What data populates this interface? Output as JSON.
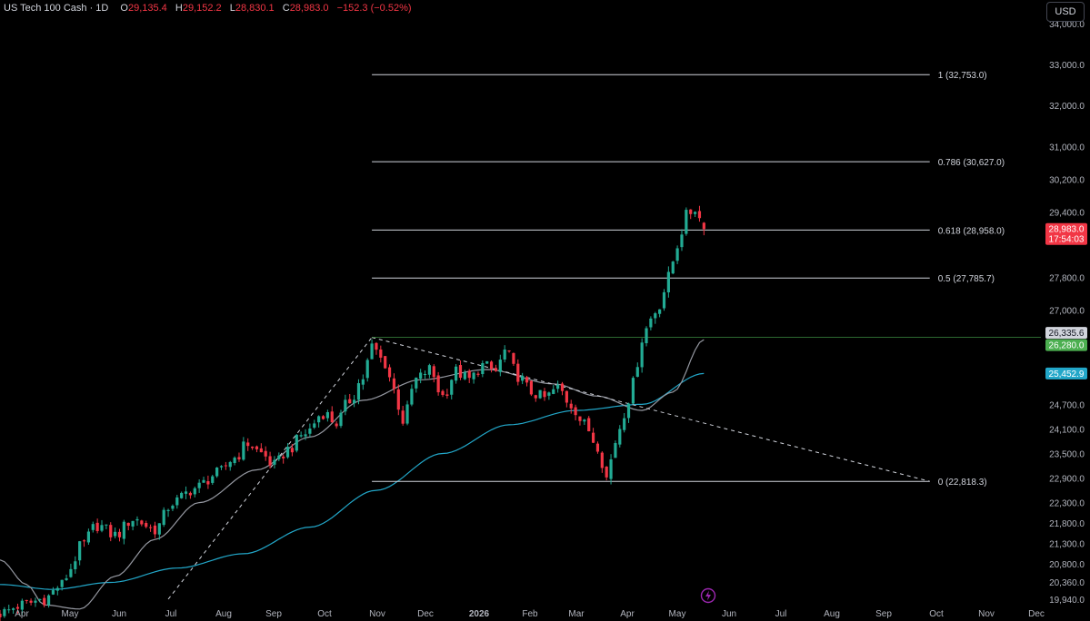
{
  "header": {
    "symbol": "US Tech 100 Cash · 1D",
    "open": "29,135.4",
    "high": "29,152.2",
    "low": "28,830.1",
    "close": "28,983.0",
    "change": "−152.3 (−0.52%)"
  },
  "currency": "USD",
  "colors": {
    "up": "#22ab94",
    "down": "#f23645",
    "ma_fast": "#9598a1",
    "ma_slow": "#22a7c9",
    "price_tag": "#f23645",
    "level_tag": "#4caf50",
    "ma_tag": "#22a7c9",
    "lightning_icon": "#9c27b0"
  },
  "chart_data": {
    "type": "candlestick",
    "x_labels": [
      "Apr",
      "May",
      "Jun",
      "Jul",
      "Aug",
      "Sep",
      "Oct",
      "Nov",
      "Dec",
      "2026",
      "Feb",
      "Mar",
      "Apr",
      "May",
      "Jun",
      "Jul",
      "Aug",
      "Sep",
      "Oct",
      "Nov",
      "Dec"
    ],
    "y_ticks": [
      "34,000.0",
      "33,000.0",
      "32,000.0",
      "31,000.0",
      "30,200.0",
      "29,400.0",
      "27,800.0",
      "27,000.0",
      "24,700.0",
      "24,100.0",
      "23,500.0",
      "22,900.0",
      "22,300.0",
      "21,800.0",
      "21,300.0",
      "20,800.0",
      "20,360.0",
      "19,940.0"
    ],
    "fib_levels": [
      {
        "label": "1 (32,753.0)",
        "value": 32753.0
      },
      {
        "label": "0.786 (30,627.0)",
        "value": 30627.0
      },
      {
        "label": "0.618 (28,958.0)",
        "value": 28958.0
      },
      {
        "label": "0.5 (27,785.7)",
        "value": 27785.7
      },
      {
        "label": "0 (22,818.3)",
        "value": 22818.3
      }
    ],
    "price_tags": [
      {
        "kind": "last",
        "value": 28983.0,
        "label": "28,983.0",
        "countdown": "17:54:03"
      },
      {
        "kind": "level",
        "value": 26335.6,
        "label": "26,335.6"
      },
      {
        "kind": "level-green",
        "value": 26280.0,
        "label": "26,280.0"
      },
      {
        "kind": "ma",
        "value": 25452.9,
        "label": "25,452.9"
      }
    ],
    "horizontal_level": 26335.6,
    "anchors": [
      {
        "t": 0,
        "v": 19600
      },
      {
        "t": 5,
        "v": 19800
      },
      {
        "t": 10,
        "v": 19950
      },
      {
        "t": 14,
        "v": 20300
      },
      {
        "t": 16,
        "v": 20700
      },
      {
        "t": 18,
        "v": 21200
      },
      {
        "t": 22,
        "v": 21750
      },
      {
        "t": 26,
        "v": 21500
      },
      {
        "t": 30,
        "v": 21900
      },
      {
        "t": 35,
        "v": 21650
      },
      {
        "t": 39,
        "v": 22300
      },
      {
        "t": 44,
        "v": 22650
      },
      {
        "t": 49,
        "v": 23000
      },
      {
        "t": 53,
        "v": 23400
      },
      {
        "t": 56,
        "v": 23750
      },
      {
        "t": 59,
        "v": 23500
      },
      {
        "t": 62,
        "v": 23200
      },
      {
        "t": 65,
        "v": 23600
      },
      {
        "t": 69,
        "v": 24000
      },
      {
        "t": 73,
        "v": 24500
      },
      {
        "t": 76,
        "v": 24250
      },
      {
        "t": 79,
        "v": 24800
      },
      {
        "t": 82,
        "v": 25350
      },
      {
        "t": 84,
        "v": 26100
      },
      {
        "t": 87,
        "v": 25700
      },
      {
        "t": 89,
        "v": 25050
      },
      {
        "t": 91,
        "v": 24300
      },
      {
        "t": 94,
        "v": 25300
      },
      {
        "t": 97,
        "v": 25550
      },
      {
        "t": 100,
        "v": 24900
      },
      {
        "t": 103,
        "v": 25500
      },
      {
        "t": 106,
        "v": 25300
      },
      {
        "t": 109,
        "v": 25650
      },
      {
        "t": 112,
        "v": 25500
      },
      {
        "t": 114,
        "v": 26000
      },
      {
        "t": 117,
        "v": 25400
      },
      {
        "t": 120,
        "v": 25000
      },
      {
        "t": 123,
        "v": 24850
      },
      {
        "t": 126,
        "v": 25100
      },
      {
        "t": 129,
        "v": 24700
      },
      {
        "t": 132,
        "v": 24200
      },
      {
        "t": 135,
        "v": 23700
      },
      {
        "t": 137,
        "v": 22900
      },
      {
        "t": 139,
        "v": 23800
      },
      {
        "t": 141,
        "v": 24500
      },
      {
        "t": 143,
        "v": 25200
      },
      {
        "t": 145,
        "v": 26300
      },
      {
        "t": 147,
        "v": 26800
      },
      {
        "t": 149,
        "v": 27150
      },
      {
        "t": 151,
        "v": 27800
      },
      {
        "t": 153,
        "v": 28600
      },
      {
        "t": 155,
        "v": 29300
      },
      {
        "t": 157,
        "v": 29500
      },
      {
        "t": 159,
        "v": 28983
      }
    ],
    "ma_slow_anchors": [
      {
        "t": 0,
        "v": 20300
      },
      {
        "t": 12,
        "v": 20180
      },
      {
        "t": 25,
        "v": 20350
      },
      {
        "t": 40,
        "v": 20700
      },
      {
        "t": 55,
        "v": 21050
      },
      {
        "t": 70,
        "v": 21700
      },
      {
        "t": 85,
        "v": 22600
      },
      {
        "t": 100,
        "v": 23500
      },
      {
        "t": 115,
        "v": 24200
      },
      {
        "t": 130,
        "v": 24550
      },
      {
        "t": 145,
        "v": 24700
      },
      {
        "t": 159,
        "v": 25452.9
      }
    ],
    "ma_fast_anchors": [
      {
        "t": 0,
        "v": 20900
      },
      {
        "t": 6,
        "v": 20300
      },
      {
        "t": 10,
        "v": 19800
      },
      {
        "t": 18,
        "v": 19700
      },
      {
        "t": 26,
        "v": 20500
      },
      {
        "t": 35,
        "v": 21400
      },
      {
        "t": 45,
        "v": 22300
      },
      {
        "t": 58,
        "v": 23100
      },
      {
        "t": 70,
        "v": 23900
      },
      {
        "t": 82,
        "v": 24800
      },
      {
        "t": 95,
        "v": 25300
      },
      {
        "t": 110,
        "v": 25550
      },
      {
        "t": 125,
        "v": 25200
      },
      {
        "t": 135,
        "v": 24900
      },
      {
        "t": 145,
        "v": 24550
      },
      {
        "t": 152,
        "v": 25000
      },
      {
        "t": 159,
        "v": 26280
      }
    ],
    "trendlines": [
      {
        "style": "dashed",
        "from": {
          "t": 38,
          "v": 19940
        },
        "to": {
          "t": 84,
          "v": 26335.6
        }
      },
      {
        "style": "dashed",
        "from": {
          "t": 84,
          "v": 26335.6
        },
        "to": {
          "t": 210,
          "v": 22818.3
        }
      }
    ],
    "grid": false,
    "legend": "none"
  }
}
